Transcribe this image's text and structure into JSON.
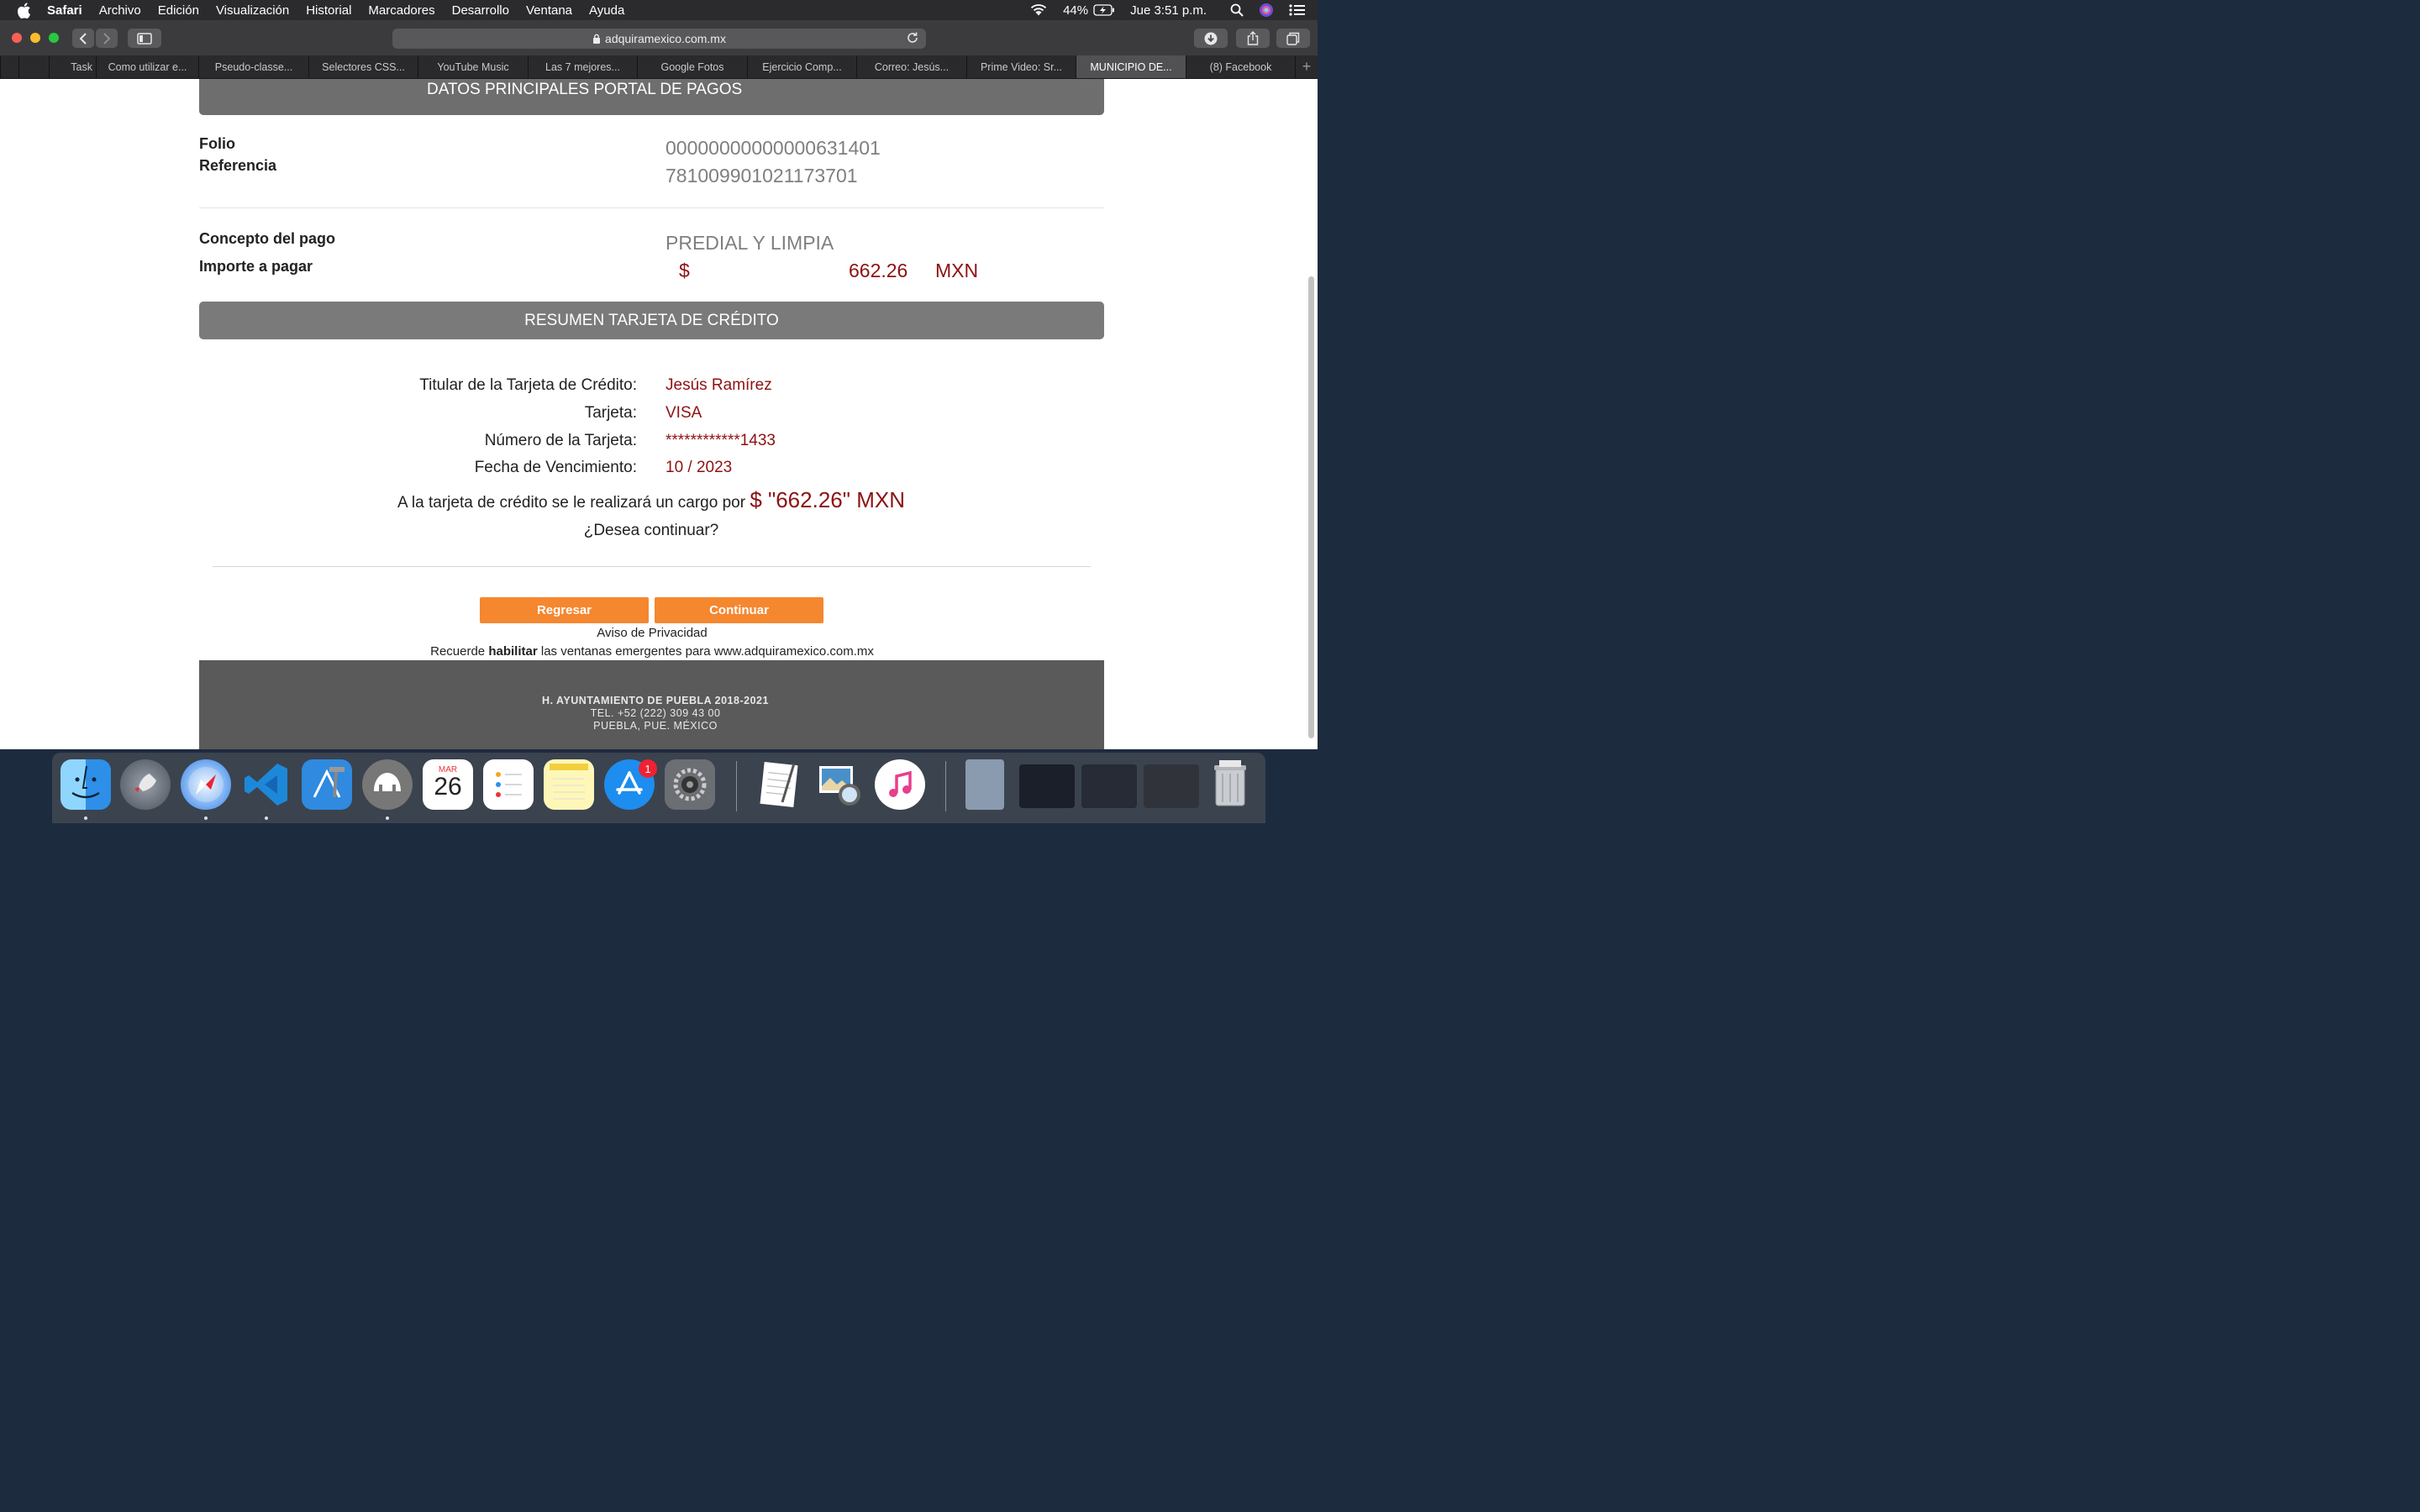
{
  "menubar": {
    "items": [
      "Safari",
      "Archivo",
      "Edición",
      "Visualización",
      "Historial",
      "Marcadores",
      "Desarrollo",
      "Ventana",
      "Ayuda"
    ],
    "battery": "44%",
    "clock": "Jue 3:51 p.m."
  },
  "toolbar": {
    "url": "adquiramexico.com.mx"
  },
  "tabs": [
    "Task",
    "Como utilizar e...",
    "Pseudo-classe...",
    "Selectores CSS...",
    "YouTube Music",
    "Las 7 mejores...",
    "Google Fotos",
    "Ejercicio Comp...",
    "Correo: Jesús...",
    "Prime Video: Sr...",
    "MUNICIPIO DE...",
    "(8) Facebook"
  ],
  "page": {
    "section_title": "DATOS PRINCIPALES PORTAL DE PAGOS",
    "folio_label": "Folio",
    "referencia_label": "Referencia",
    "folio_value": "00000000000000631401",
    "referencia_value": "781009901021173701",
    "concepto_label": "Concepto del pago",
    "importe_label": "Importe a pagar",
    "concepto_value": "PREDIAL Y LIMPIA",
    "importe_symbol": "$",
    "importe_amount": "662.26",
    "importe_currency": "MXN",
    "card_section_title": "RESUMEN TARJETA DE CRÉDITO",
    "titular_label": "Titular de la Tarjeta de Crédito:",
    "titular_value": "Jesús Ramírez",
    "tarjeta_label": "Tarjeta:",
    "tarjeta_value": "VISA",
    "numero_label": "Número de la Tarjeta:",
    "numero_value": "************1433",
    "vencimiento_label": "Fecha de Vencimiento:",
    "vencimiento_value": "10 / 2023",
    "charge_text": "A la tarjeta de crédito se le realizará un cargo por",
    "charge_amount": "$ \"662.26\" MXN",
    "confirm_question": "¿Desea continuar?",
    "back_button": "Regresar",
    "continue_button": "Continuar",
    "privacy_link": "Aviso de Privacidad",
    "reminder_prefix": "Recuerde",
    "reminder_bold": "habilitar",
    "reminder_suffix": "las ventanas emergentes para www.adquiramexico.com.mx",
    "footer": {
      "line1": "H. AYUNTAMIENTO DE PUEBLA 2018-2021",
      "line2": "TEL. +52 (222) 309 43 00",
      "line3": "PUEBLA, PUE. MÉXICO"
    }
  },
  "dock": {
    "calendar_month": "MAR",
    "calendar_day": "26",
    "appstore_badge": "1",
    "icons": [
      "finder-icon",
      "launchpad-icon",
      "safari-icon",
      "vscode-icon",
      "xcode-icon",
      "sequel-pro-icon",
      "calendar-icon",
      "reminders-icon",
      "notes-icon",
      "app-store-icon",
      "system-preferences-icon",
      "textedit-icon",
      "preview-icon",
      "itunes-icon",
      "downloads-stack-icon",
      "window-thumbnail-1",
      "window-thumbnail-2",
      "window-thumbnail-3",
      "trash-icon"
    ]
  }
}
